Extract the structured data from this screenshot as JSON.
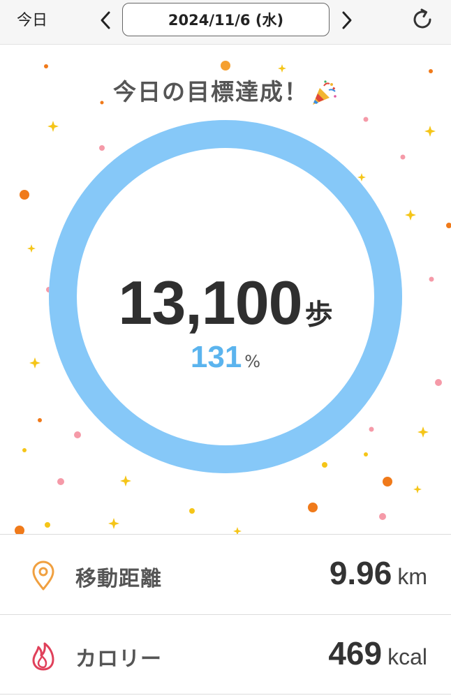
{
  "header": {
    "today_label": "今日",
    "date": "2024/11/6 (水)",
    "prev_icon": "chevron-left-icon",
    "next_icon": "chevron-right-icon",
    "refresh_icon": "refresh-icon"
  },
  "hero": {
    "title": "今日の目標達成！",
    "title_icon": "party-popper-icon",
    "steps_value": "13,100",
    "steps_unit": "歩",
    "percent_value": "131",
    "percent_unit": "%",
    "progress_fraction": 1.0,
    "ring_color": "#86c8f8"
  },
  "stats": [
    {
      "icon": "location-pin-icon",
      "label": "移動距離",
      "value": "9.96",
      "unit": "km",
      "icon_color": "#f0a040"
    },
    {
      "icon": "flame-icon",
      "label": "カロリー",
      "value": "469",
      "unit": "kcal",
      "icon_color": "#e0405a"
    }
  ],
  "colors": {
    "accent_blue": "#5bb4ee",
    "confetti_orange": "#f07a1a",
    "confetti_pink": "#f59aa8",
    "confetti_yellow": "#f5c518"
  }
}
